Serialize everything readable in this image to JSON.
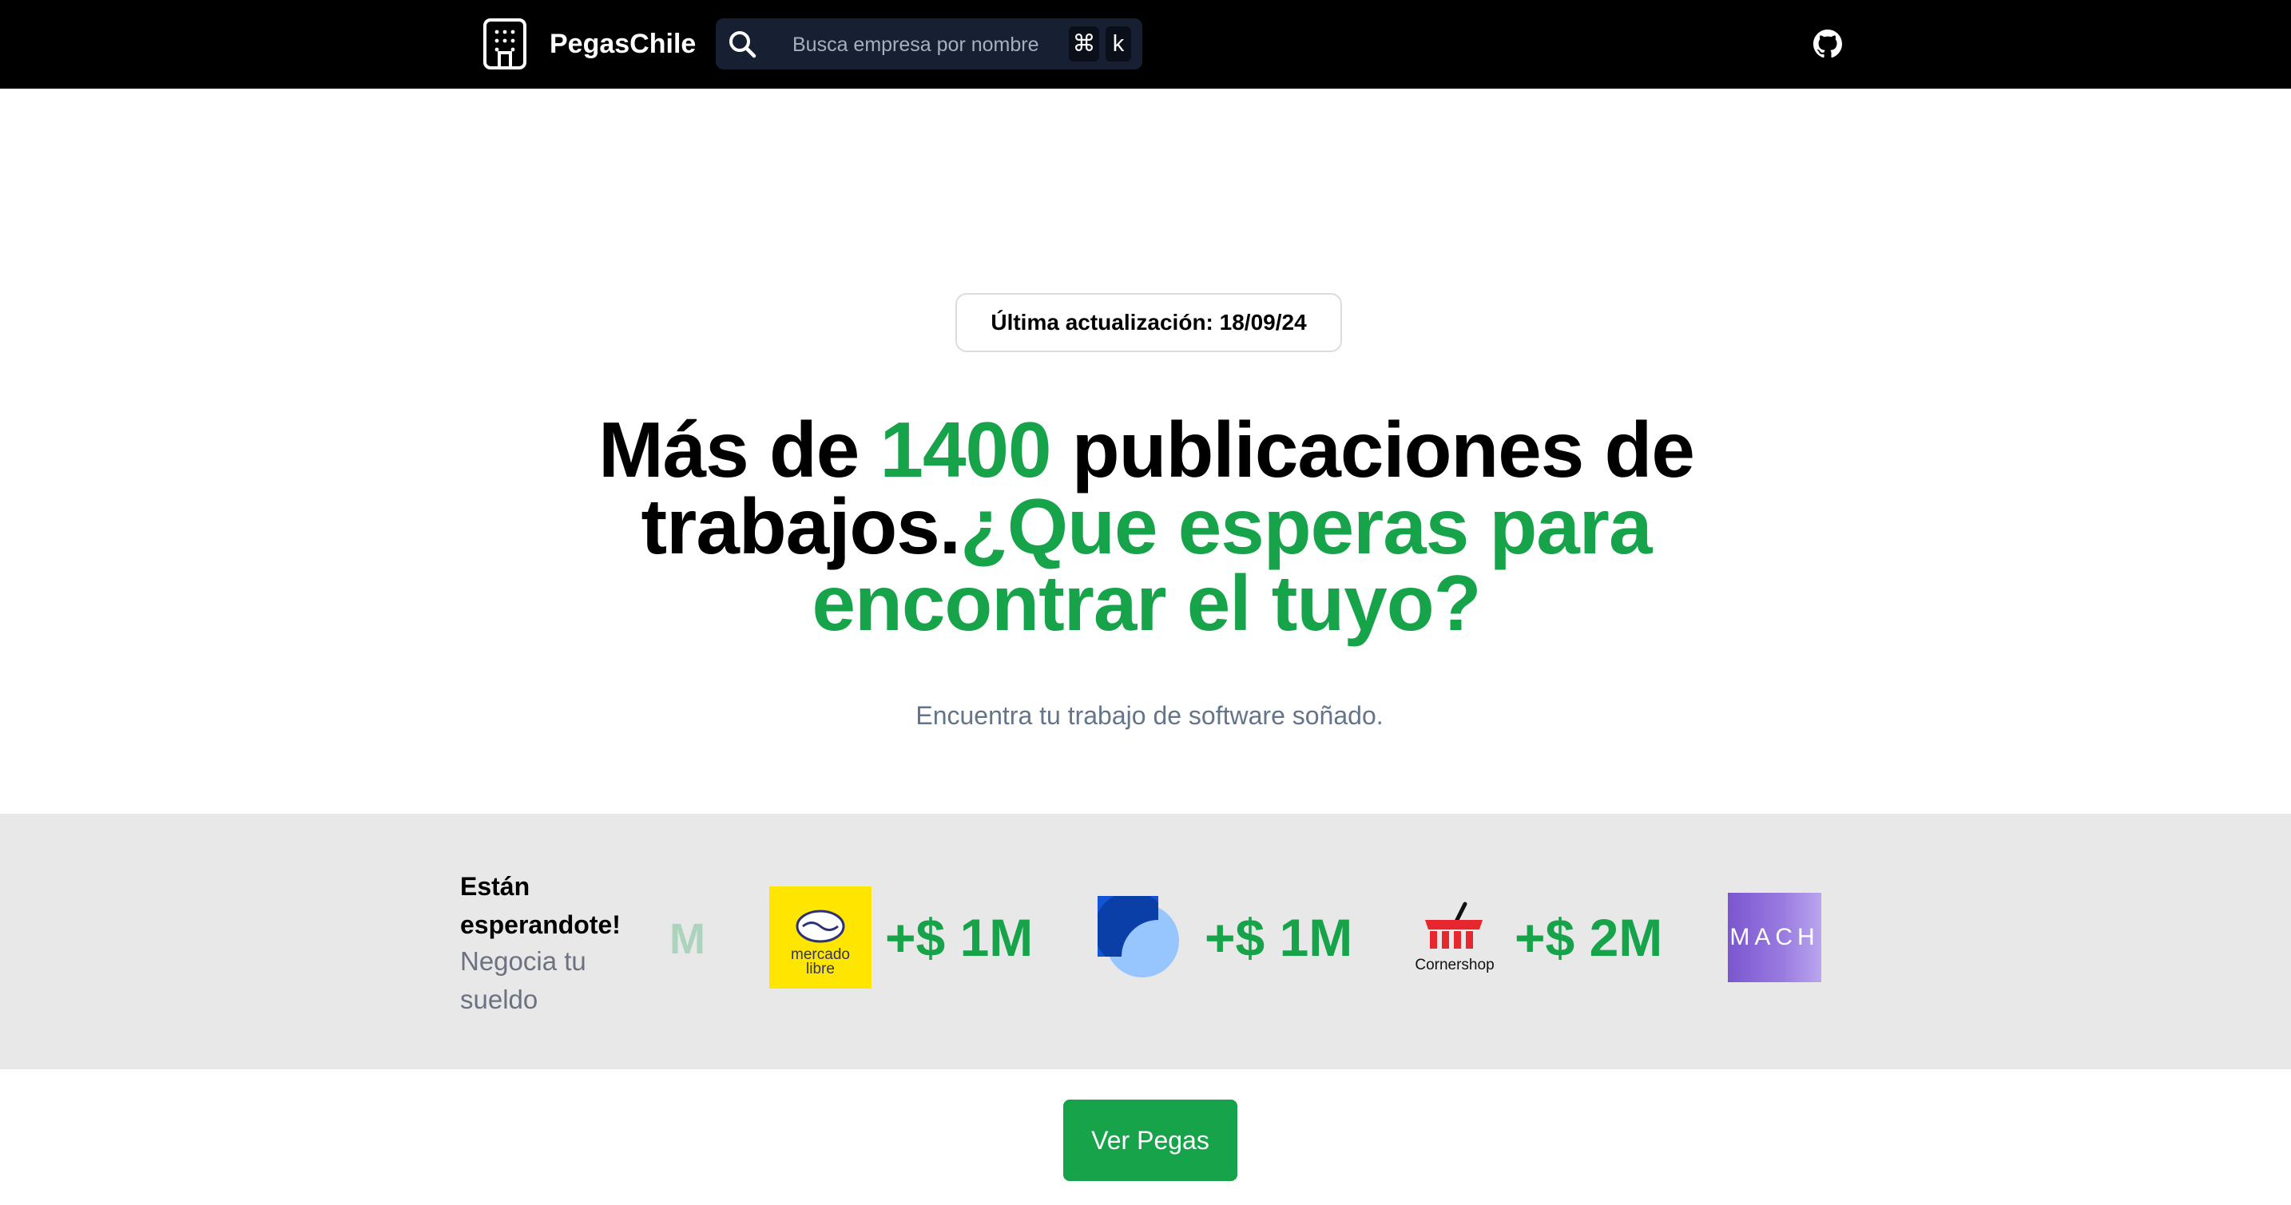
{
  "header": {
    "brand": "PegasChile",
    "search": {
      "placeholder": "Busca empresa por nombre",
      "shortcut_cmd": "⌘",
      "shortcut_key": "k"
    },
    "icons": [
      "building-icon",
      "search-icon",
      "github-icon"
    ]
  },
  "hero": {
    "badge": "Última actualización: 18/09/24",
    "headline": {
      "part1": "Más de ",
      "count": "1400",
      "part2": " publicaciones de trabajos.",
      "highlight": "¿Que esperas para encontrar el tuyo?"
    },
    "subtitle": "Encuentra tu trabajo de software soñado."
  },
  "companies_band": {
    "title": "Están esperandote!",
    "subtitle": "Negocia tu sueldo",
    "faded_fragment": "M",
    "items": [
      {
        "logo": "mercado-libre-logo",
        "logo_text_1": "mercado",
        "logo_text_2": "libre",
        "amount": "+$ 1M"
      },
      {
        "logo": "blue-shapes-logo",
        "amount": "+$ 1M"
      },
      {
        "logo": "cornershop-logo",
        "logo_text": "Cornershop",
        "amount": "+$ 2M"
      },
      {
        "logo": "mach-logo",
        "logo_text": "MACH"
      }
    ]
  },
  "cta": {
    "label": "Ver Pegas"
  },
  "colors": {
    "accent": "#16a34a",
    "nav_bg": "#000000",
    "band_bg": "#e8e8e9",
    "search_bg": "#172033"
  }
}
